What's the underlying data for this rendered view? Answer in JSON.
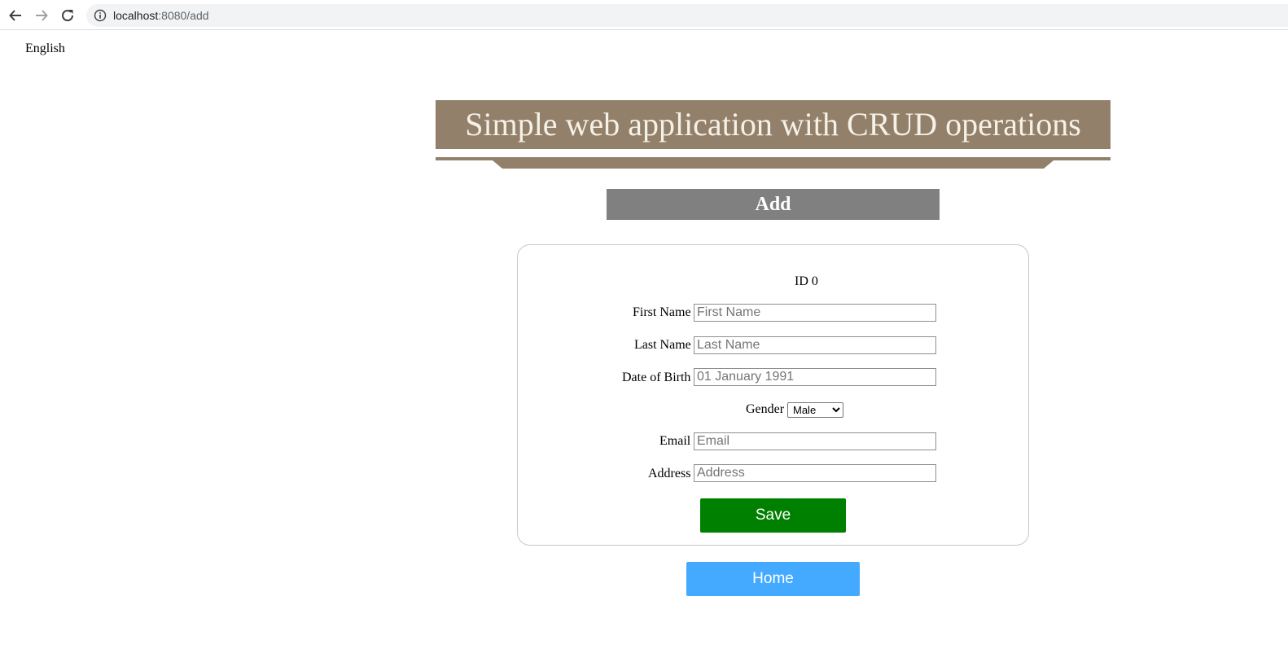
{
  "browser": {
    "url_host": "localhost",
    "url_path": ":8080/add"
  },
  "language": {
    "label": "English"
  },
  "banner": {
    "title": "Simple web application with CRUD operations",
    "color": "#93806a"
  },
  "section": {
    "title": "Add"
  },
  "form": {
    "id_text": "ID 0",
    "first_name": {
      "label": "First Name",
      "placeholder": "First Name",
      "value": ""
    },
    "last_name": {
      "label": "Last Name",
      "placeholder": "Last Name",
      "value": ""
    },
    "date_of_birth": {
      "label": "Date of Birth",
      "placeholder": "01 January 1991",
      "value": ""
    },
    "gender": {
      "label": "Gender",
      "selected": "Male"
    },
    "email": {
      "label": "Email",
      "placeholder": "Email",
      "value": ""
    },
    "address": {
      "label": "Address",
      "placeholder": "Address",
      "value": ""
    },
    "save_label": "Save",
    "save_color": "#008000"
  },
  "home_button": {
    "label": "Home",
    "color": "#44aaff"
  },
  "icons": {
    "back": "arrow-left-icon",
    "forward": "arrow-right-icon",
    "reload": "reload-icon",
    "site_info": "info-icon"
  }
}
